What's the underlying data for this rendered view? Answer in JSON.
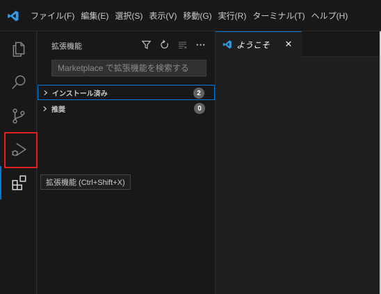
{
  "menubar": {
    "items": [
      "ファイル(F)",
      "編集(E)",
      "選択(S)",
      "表示(V)",
      "移動(G)",
      "実行(R)",
      "ターミナル(T)",
      "ヘルプ(H)"
    ]
  },
  "activitybar": {
    "items": [
      {
        "name": "explorer-icon"
      },
      {
        "name": "search-icon"
      },
      {
        "name": "source-control-icon"
      },
      {
        "name": "run-debug-icon"
      },
      {
        "name": "extensions-icon",
        "active": true
      }
    ]
  },
  "sidebar": {
    "title": "拡張機能",
    "actions": [
      "filter-icon",
      "refresh-icon",
      "clear-icon",
      "more-icon"
    ],
    "search_placeholder": "Marketplace で拡張機能を検索する",
    "sections": [
      {
        "label": "インストール済み",
        "count": "2",
        "focused": true
      },
      {
        "label": "推奨",
        "count": "0",
        "focused": false
      }
    ]
  },
  "tooltip": {
    "text": "拡張機能 (Ctrl+Shift+X)"
  },
  "editor": {
    "tab": {
      "label": "ようこそ"
    }
  },
  "colors": {
    "accent": "#0078d4",
    "highlight": "#e51f1f",
    "vscode_blue": "#2f9be9"
  }
}
